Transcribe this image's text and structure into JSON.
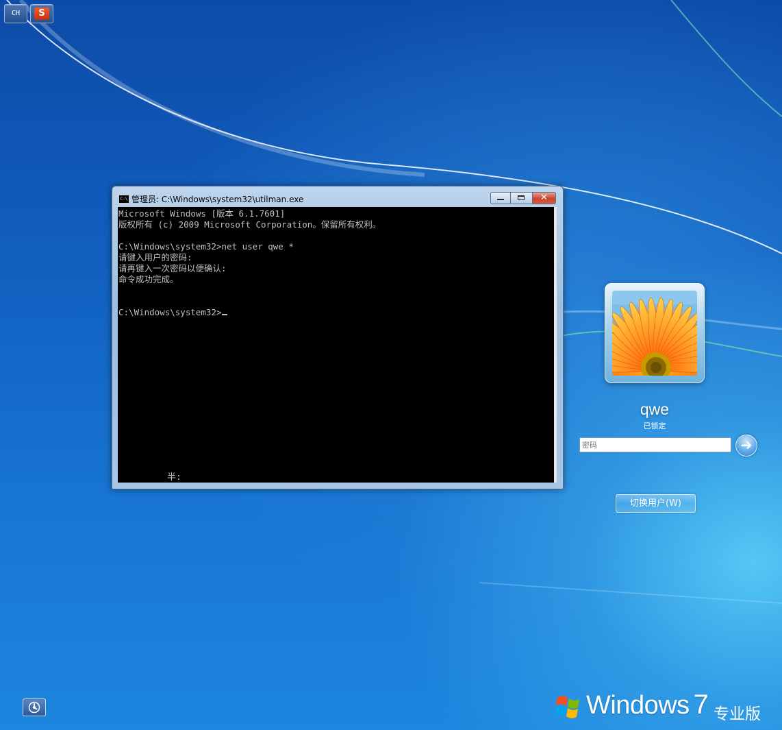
{
  "language_bar": {
    "lang_label": "CH",
    "ime_label": "S"
  },
  "console_window": {
    "title": "管理员: C:\\Windows\\system32\\utilman.exe",
    "icon_label": "C:\\",
    "lines": [
      "Microsoft Windows [版本 6.1.7601]",
      "版权所有 (c) 2009 Microsoft Corporation。保留所有权利。",
      "",
      "C:\\Windows\\system32>net user qwe *",
      "请键入用户的密码:",
      "请再键入一次密码以便确认:",
      "命令成功完成。",
      "",
      "",
      "C:\\Windows\\system32>"
    ],
    "ime_status": "半:",
    "close_label": "✕"
  },
  "login": {
    "username": "qwe",
    "status": "已锁定",
    "password_placeholder": "密码",
    "go_arrow": "➜",
    "switch_user_label": "切换用户(W)"
  },
  "brand": {
    "windows": "Windows",
    "version": "7",
    "edition": "专业版"
  },
  "colors": {
    "desktop_blue": "#1262c2",
    "console_bg": "#000000",
    "console_text": "#c0c0c0"
  }
}
